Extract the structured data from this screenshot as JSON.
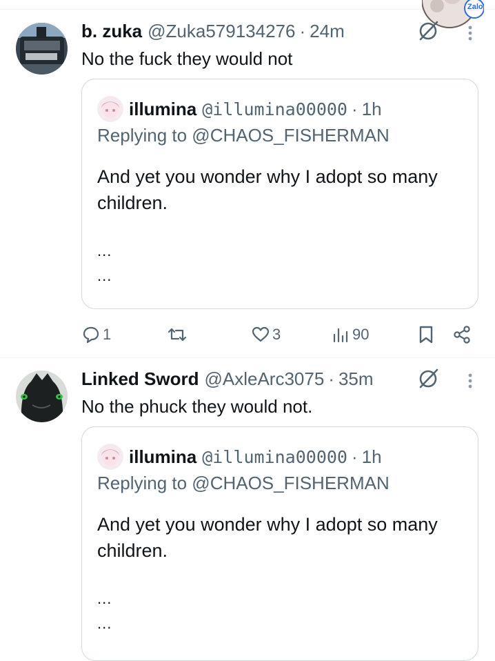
{
  "colors": {
    "text": "#0f1419",
    "muted": "#536471",
    "border": "#cfd9de",
    "divider": "#eff3f4"
  },
  "overlay": {
    "app_label": "Zalo",
    "app_icon": "zalo-bubble-icon"
  },
  "posts": [
    {
      "author_name": "b. zuka",
      "author_handle": "@Zuka579134276",
      "separator": "·",
      "time": "24m",
      "text": "No the fuck they would not",
      "quote": {
        "author_name": "illumina",
        "author_handle": "@illumina00000",
        "separator": "·",
        "time": "1h",
        "replying_to": "Replying to @CHAOS_FISHERMAN",
        "text": "And yet you wonder why I adopt so many children.",
        "ellipsis_1": "...",
        "ellipsis_2": "..."
      },
      "actions": {
        "replies": "1",
        "reposts": "",
        "likes": "3",
        "views": "90"
      }
    },
    {
      "author_name": "Linked Sword",
      "author_handle": "@AxleArc3075",
      "separator": "·",
      "time": "35m",
      "text": "No the phuck they would not.",
      "quote": {
        "author_name": "illumina",
        "author_handle": "@illumina00000",
        "separator": "·",
        "time": "1h",
        "replying_to": "Replying to @CHAOS_FISHERMAN",
        "text": "And yet you wonder why I adopt so many children.",
        "ellipsis_1": "...",
        "ellipsis_2": "..."
      }
    }
  ]
}
